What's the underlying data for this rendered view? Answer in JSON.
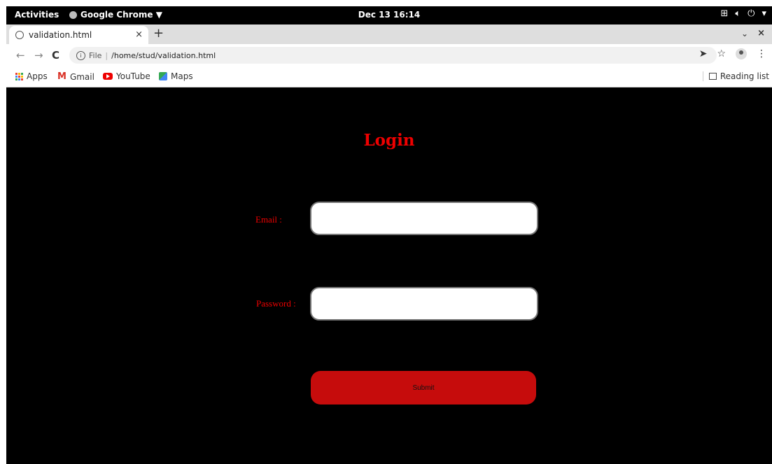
{
  "system_bar": {
    "activities": "Activities",
    "app_menu": "Google Chrome ▼",
    "clock": "Dec 13  16:14"
  },
  "browser": {
    "tab": {
      "title": "validation.html",
      "close": "×"
    },
    "new_tab": "+",
    "tab_search": "⌄",
    "window_close": "×",
    "address": {
      "scheme": "File",
      "separator": "|",
      "path": "/home/stud/validation.html"
    },
    "bookmarks": [
      {
        "label": "Apps",
        "icon": "apps-grid-icon"
      },
      {
        "label": "Gmail",
        "icon": "gmail-icon"
      },
      {
        "label": "YouTube",
        "icon": "youtube-icon"
      },
      {
        "label": "Maps",
        "icon": "maps-icon"
      }
    ],
    "reading_list": "Reading list"
  },
  "page": {
    "title": "Login",
    "email_label": "Email :",
    "email_value": "",
    "password_label": "Password :",
    "password_value": "",
    "submit_label": "Submit"
  },
  "colors": {
    "page_background": "#000000",
    "label_text": "#e00000",
    "submit_background": "#c60c0c"
  }
}
